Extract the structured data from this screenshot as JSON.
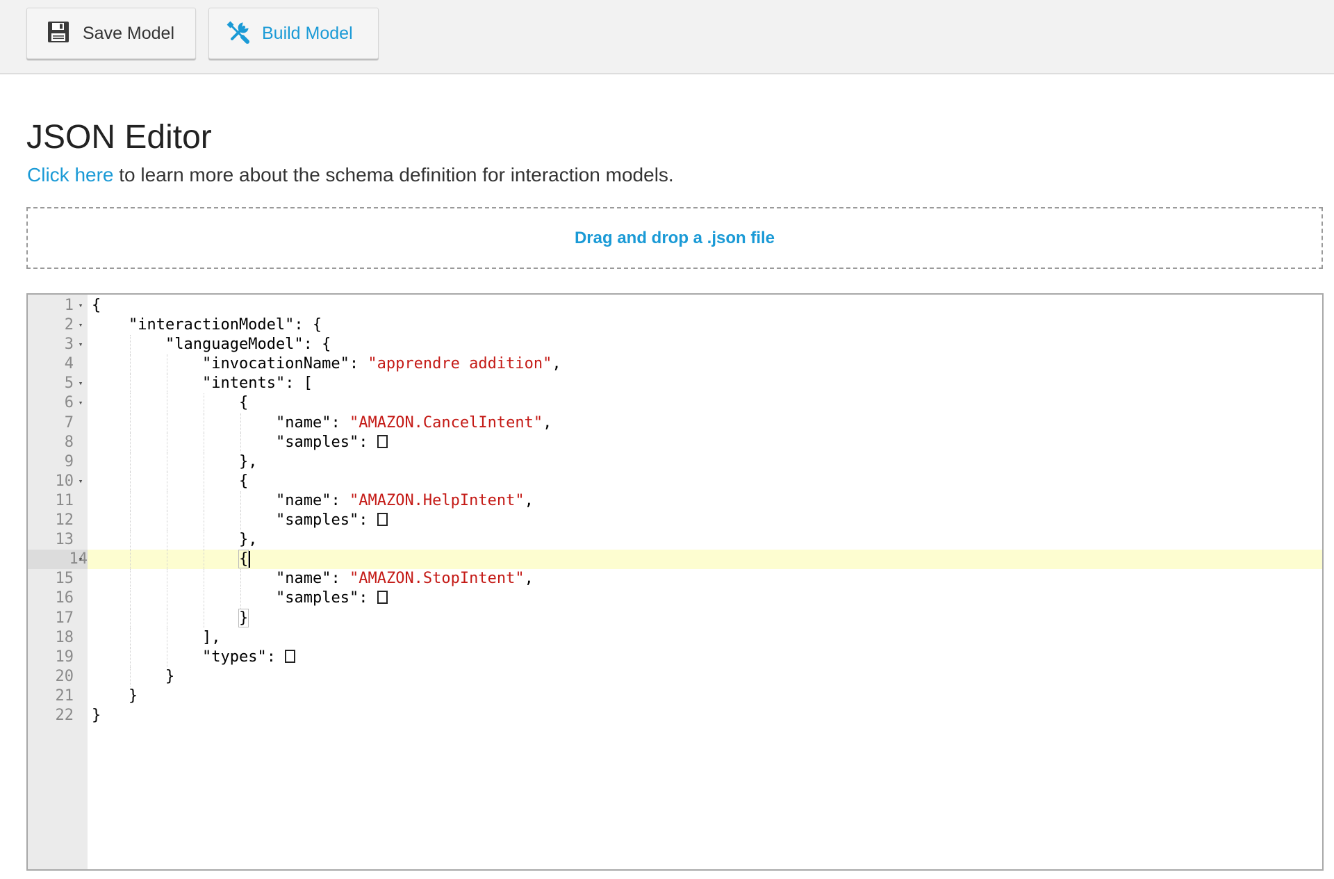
{
  "toolbar": {
    "save_label": "Save Model",
    "build_label": "Build Model"
  },
  "page": {
    "title": "JSON Editor",
    "link_text": "Click here",
    "subtitle_rest": " to learn more about the schema definition for interaction models."
  },
  "dropzone": {
    "label": "Drag and drop a .json file"
  },
  "editor": {
    "active_line": 14,
    "lines": [
      {
        "n": "1",
        "fold": true,
        "indent": 0,
        "parts": [
          [
            "p",
            "{"
          ]
        ]
      },
      {
        "n": "2",
        "fold": true,
        "indent": 1,
        "parts": [
          [
            "p",
            "\"interactionModel\": {"
          ]
        ]
      },
      {
        "n": "3",
        "fold": true,
        "indent": 2,
        "parts": [
          [
            "p",
            "\"languageModel\": {"
          ]
        ]
      },
      {
        "n": "4",
        "fold": false,
        "indent": 3,
        "parts": [
          [
            "p",
            "\"invocationName\": "
          ],
          [
            "s",
            "\"apprendre addition\""
          ],
          [
            "p",
            ","
          ]
        ]
      },
      {
        "n": "5",
        "fold": true,
        "indent": 3,
        "parts": [
          [
            "p",
            "\"intents\": ["
          ]
        ]
      },
      {
        "n": "6",
        "fold": true,
        "indent": 4,
        "parts": [
          [
            "p",
            "{"
          ]
        ]
      },
      {
        "n": "7",
        "fold": false,
        "indent": 5,
        "parts": [
          [
            "p",
            "\"name\": "
          ],
          [
            "s",
            "\"AMAZON.CancelIntent\""
          ],
          [
            "p",
            ","
          ]
        ]
      },
      {
        "n": "8",
        "fold": false,
        "indent": 5,
        "parts": [
          [
            "p",
            "\"samples\": "
          ],
          [
            "e",
            ""
          ]
        ]
      },
      {
        "n": "9",
        "fold": false,
        "indent": 4,
        "parts": [
          [
            "p",
            "},"
          ]
        ]
      },
      {
        "n": "10",
        "fold": true,
        "indent": 4,
        "parts": [
          [
            "p",
            "{"
          ]
        ]
      },
      {
        "n": "11",
        "fold": false,
        "indent": 5,
        "parts": [
          [
            "p",
            "\"name\": "
          ],
          [
            "s",
            "\"AMAZON.HelpIntent\""
          ],
          [
            "p",
            ","
          ]
        ]
      },
      {
        "n": "12",
        "fold": false,
        "indent": 5,
        "parts": [
          [
            "p",
            "\"samples\": "
          ],
          [
            "e",
            ""
          ]
        ]
      },
      {
        "n": "13",
        "fold": false,
        "indent": 4,
        "parts": [
          [
            "p",
            "},"
          ]
        ]
      },
      {
        "n": "14",
        "fold": true,
        "indent": 4,
        "parts": [
          [
            "b",
            "{"
          ],
          [
            "c",
            ""
          ]
        ]
      },
      {
        "n": "15",
        "fold": false,
        "indent": 5,
        "parts": [
          [
            "p",
            "\"name\": "
          ],
          [
            "s",
            "\"AMAZON.StopIntent\""
          ],
          [
            "p",
            ","
          ]
        ]
      },
      {
        "n": "16",
        "fold": false,
        "indent": 5,
        "parts": [
          [
            "p",
            "\"samples\": "
          ],
          [
            "e",
            ""
          ]
        ]
      },
      {
        "n": "17",
        "fold": false,
        "indent": 4,
        "parts": [
          [
            "b",
            "}"
          ]
        ]
      },
      {
        "n": "18",
        "fold": false,
        "indent": 3,
        "parts": [
          [
            "p",
            "],"
          ]
        ]
      },
      {
        "n": "19",
        "fold": false,
        "indent": 3,
        "parts": [
          [
            "p",
            "\"types\": "
          ],
          [
            "e",
            ""
          ]
        ]
      },
      {
        "n": "20",
        "fold": false,
        "indent": 2,
        "parts": [
          [
            "p",
            "}"
          ]
        ]
      },
      {
        "n": "21",
        "fold": false,
        "indent": 1,
        "parts": [
          [
            "p",
            "}"
          ]
        ]
      },
      {
        "n": "22",
        "fold": false,
        "indent": 0,
        "parts": [
          [
            "p",
            "}"
          ]
        ]
      }
    ]
  },
  "colors": {
    "accent": "#1a9ad6",
    "string": "#c41a16",
    "active_line": "#fdfdd0",
    "gutter": "#ebebeb"
  },
  "icons": {
    "save": "floppy-disk-icon",
    "build": "wrench-screwdriver-icon"
  }
}
